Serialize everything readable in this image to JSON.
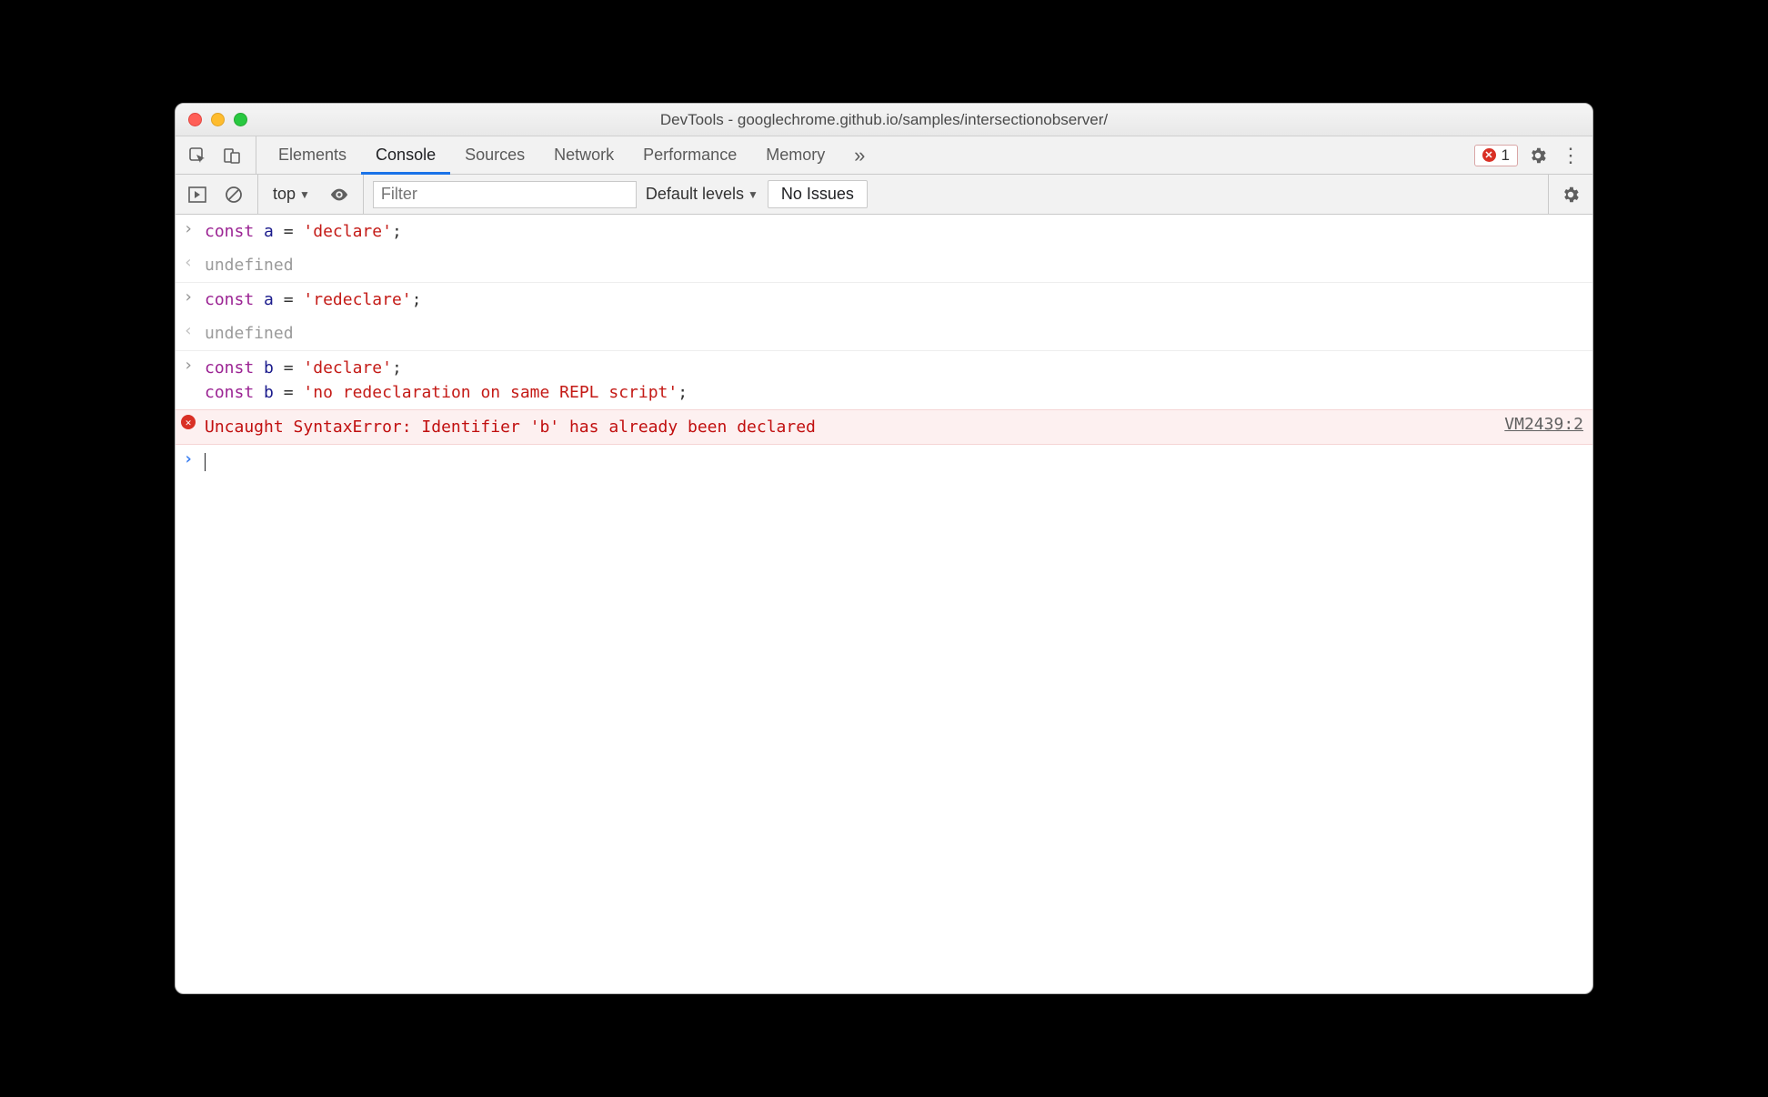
{
  "window": {
    "title": "DevTools - googlechrome.github.io/samples/intersectionobserver/"
  },
  "tabs": {
    "items": [
      "Elements",
      "Console",
      "Sources",
      "Network",
      "Performance",
      "Memory"
    ],
    "active": "Console",
    "error_count": "1"
  },
  "toolbar": {
    "context": "top",
    "filter_placeholder": "Filter",
    "levels": "Default levels",
    "issues": "No Issues"
  },
  "console": {
    "entries": [
      {
        "kind": "input",
        "tokens": [
          [
            "kw",
            "const"
          ],
          [
            "sp",
            " "
          ],
          [
            "var",
            "a"
          ],
          [
            "sp",
            " "
          ],
          [
            "op",
            "="
          ],
          [
            "sp",
            " "
          ],
          [
            "str",
            "'declare'"
          ],
          [
            "op",
            ";"
          ]
        ]
      },
      {
        "kind": "output",
        "text": "undefined"
      },
      {
        "kind": "input",
        "tokens": [
          [
            "kw",
            "const"
          ],
          [
            "sp",
            " "
          ],
          [
            "var",
            "a"
          ],
          [
            "sp",
            " "
          ],
          [
            "op",
            "="
          ],
          [
            "sp",
            " "
          ],
          [
            "str",
            "'redeclare'"
          ],
          [
            "op",
            ";"
          ]
        ]
      },
      {
        "kind": "output",
        "text": "undefined"
      },
      {
        "kind": "input-multi",
        "lines": [
          [
            [
              "kw",
              "const"
            ],
            [
              "sp",
              " "
            ],
            [
              "var",
              "b"
            ],
            [
              "sp",
              " "
            ],
            [
              "op",
              "="
            ],
            [
              "sp",
              " "
            ],
            [
              "str",
              "'declare'"
            ],
            [
              "op",
              ";"
            ]
          ],
          [
            [
              "kw",
              "const"
            ],
            [
              "sp",
              " "
            ],
            [
              "var",
              "b"
            ],
            [
              "sp",
              " "
            ],
            [
              "op",
              "="
            ],
            [
              "sp",
              " "
            ],
            [
              "str",
              "'no redeclaration on same REPL script'"
            ],
            [
              "op",
              ";"
            ]
          ]
        ]
      },
      {
        "kind": "error",
        "text": "Uncaught SyntaxError: Identifier 'b' has already been declared",
        "source": "VM2439:2"
      }
    ]
  }
}
